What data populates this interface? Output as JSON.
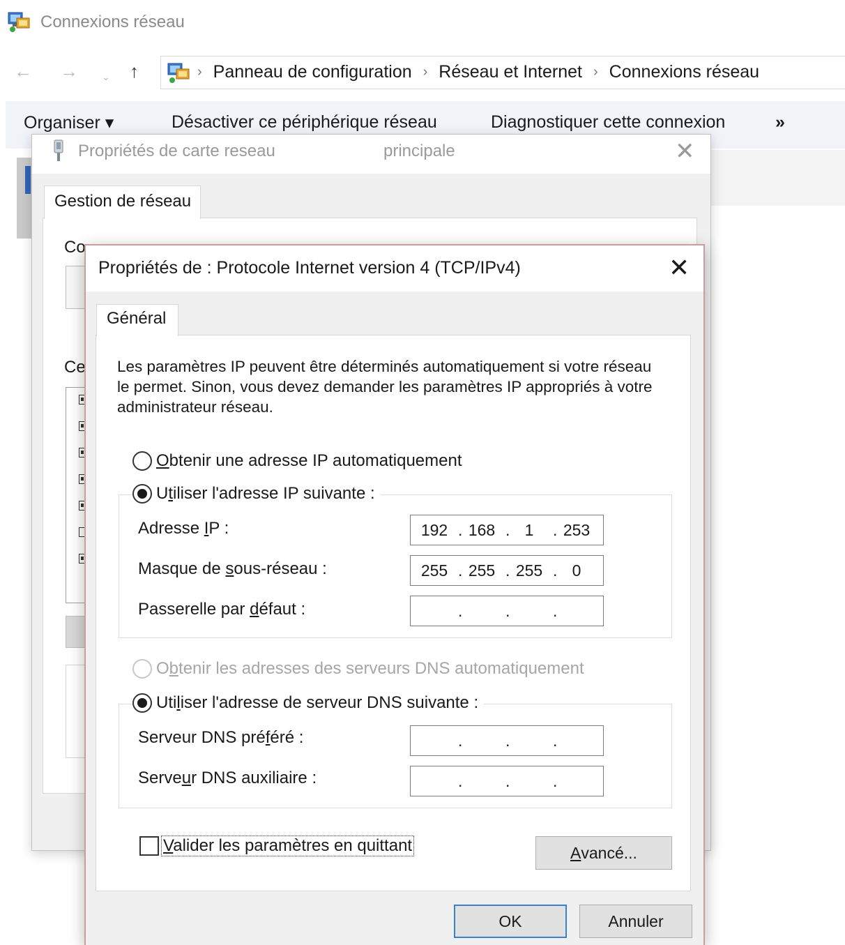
{
  "explorer": {
    "title": "Connexions réseau",
    "breadcrumb": [
      "Panneau de configuration",
      "Réseau et Internet",
      "Connexions réseau"
    ],
    "toolbar": {
      "organize": "Organiser ▾",
      "disable": "Désactiver ce périphérique réseau",
      "diagnose": "Diagnostiquer cette connexion",
      "more": "»"
    }
  },
  "adapter_dialog": {
    "title": "Propriétés de carte reseau",
    "title_suffix": "principale",
    "tab": "Gestion de réseau",
    "peek_label_1": "Co",
    "peek_label_2": "Ce",
    "list_checkboxes": [
      true,
      true,
      true,
      true,
      true,
      false,
      true
    ]
  },
  "ipv4_dialog": {
    "title": "Propriétés de : Protocole Internet version 4 (TCP/IPv4)",
    "tab": "Général",
    "intro": "Les paramètres IP peuvent être déterminés automatiquement si votre réseau le permet. Sinon, vous devez demander les paramètres IP appropriés à votre administrateur réseau.",
    "ip_mode": {
      "auto_label": {
        "pre": "",
        "key": "O",
        "post": "btenir une adresse IP automatiquement"
      },
      "manual_label": {
        "pre": "U",
        "key": "t",
        "post": "iliser l'adresse IP suivante :"
      },
      "selected": "manual"
    },
    "ip_address": {
      "label": {
        "pre": "Adresse ",
        "key": "I",
        "post": "P :"
      },
      "octets": [
        "192",
        "168",
        "1",
        "253"
      ]
    },
    "subnet_mask": {
      "label": {
        "pre": "Masque de ",
        "key": "s",
        "post": "ous-réseau :"
      },
      "octets": [
        "255",
        "255",
        "255",
        "0"
      ]
    },
    "gateway": {
      "label": {
        "pre": "Passerelle par ",
        "key": "d",
        "post": "éfaut :"
      },
      "octets": [
        "",
        "",
        "",
        ""
      ]
    },
    "dns_mode": {
      "auto_label": {
        "pre": "O",
        "key": "b",
        "post": "tenir les adresses des serveurs DNS automatiquement"
      },
      "manual_label": {
        "pre": "Uti",
        "key": "l",
        "post": "iser l'adresse de serveur DNS suivante :"
      },
      "selected": "manual",
      "auto_disabled": true
    },
    "dns_preferred": {
      "label": {
        "pre": "Serveur DNS pré",
        "key": "f",
        "post": "éré :"
      },
      "octets": [
        "",
        "",
        "",
        ""
      ]
    },
    "dns_alternate": {
      "label": {
        "pre": "Serve",
        "key": "u",
        "post": "r DNS auxiliaire :"
      },
      "octets": [
        "",
        "",
        "",
        ""
      ]
    },
    "validate_on_exit": {
      "label": {
        "pre": "",
        "key": "V",
        "post": "alider les paramètres en quittant"
      },
      "checked": false
    },
    "advanced_button": {
      "pre": "",
      "key": "A",
      "post": "vancé..."
    },
    "ok_button": "OK",
    "cancel_button": "Annuler"
  }
}
